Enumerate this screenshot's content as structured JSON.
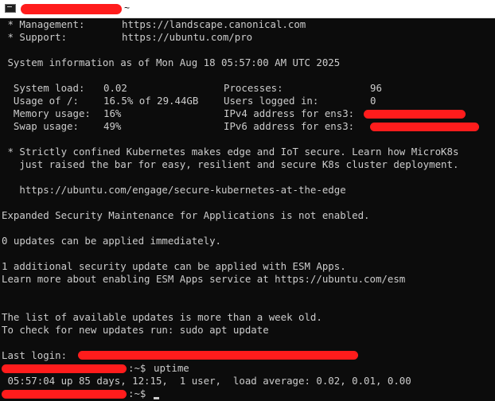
{
  "window": {
    "title_suffix": "~"
  },
  "terminal": {
    "mgmt_label": " * Management:",
    "mgmt_url": "https://landscape.canonical.com",
    "support_label": " * Support:",
    "support_url": "https://ubuntu.com/pro",
    "sysinfo": " System information as of Mon Aug 18 05:57:00 AM UTC 2025",
    "sysload_label": "  System load:",
    "sysload_value": "0.02",
    "processes_label": "Processes:",
    "processes_value": "96",
    "usage_label": "  Usage of /:",
    "usage_value": "16.5% of 29.44GB",
    "users_label": "Users logged in:",
    "users_value": "0",
    "memory_label": "  Memory usage:",
    "memory_value": "16%",
    "ipv4_label": "IPv4 address for ens3:",
    "swap_label": "  Swap usage:",
    "swap_value": "49%",
    "ipv6_label": "IPv6 address for ens3:",
    "k8s_line1": " * Strictly confined Kubernetes makes edge and IoT secure. Learn how MicroK8s",
    "k8s_line2": "   just raised the bar for easy, resilient and secure K8s cluster deployment.",
    "k8s_url": "   https://ubuntu.com/engage/secure-kubernetes-at-the-edge",
    "esm_status": "Expanded Security Maintenance for Applications is not enabled.",
    "updates_now": "0 updates can be applied immediately.",
    "esm_update": "1 additional security update can be applied with ESM Apps.",
    "esm_learn": "Learn more about enabling ESM Apps service at https://ubuntu.com/esm",
    "list_old": "The list of available updates is more than a week old.",
    "check_updates": "To check for new updates run: sudo apt update",
    "last_login_label": "Last login:",
    "prompt_suffix": ":~$",
    "command": "uptime",
    "uptime_output": " 05:57:04 up 85 days, 12:15,  1 user,  load average: 0.02, 0.01, 0.00"
  }
}
